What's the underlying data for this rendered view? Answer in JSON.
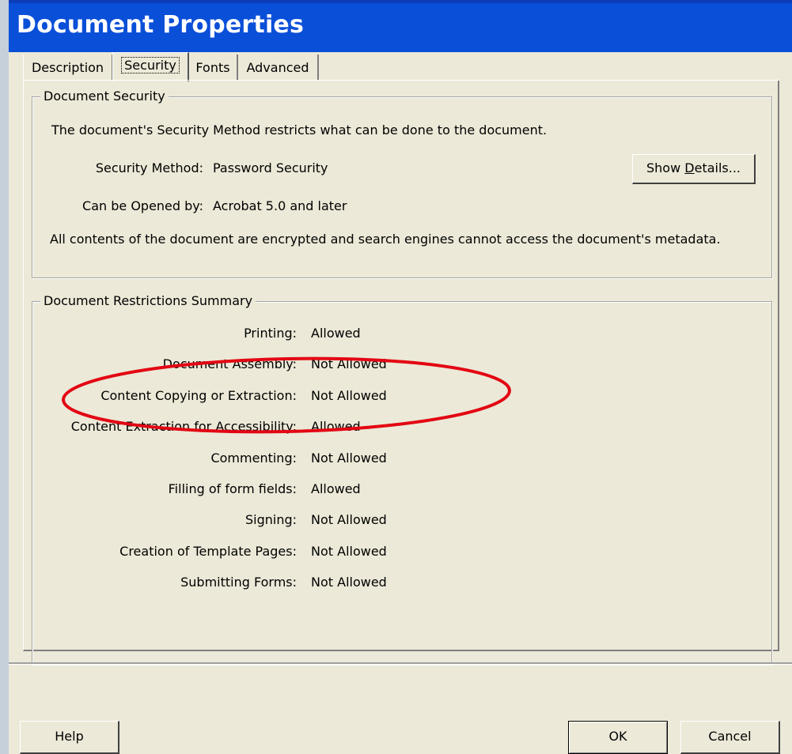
{
  "window": {
    "title": "Document Properties"
  },
  "tabs": [
    {
      "label": "Description",
      "active": false
    },
    {
      "label": "Security",
      "active": true
    },
    {
      "label": "Fonts",
      "active": false
    },
    {
      "label": "Advanced",
      "active": false
    }
  ],
  "security_group": {
    "legend": "Document Security",
    "intro": "The document's Security Method restricts what can be done to the document.",
    "method_label": "Security Method:",
    "method_value": "Password Security",
    "opened_label": "Can be Opened by:",
    "opened_value": "Acrobat 5.0 and later",
    "encryption_note": "All contents of the document are encrypted and search engines cannot access the document's metadata.",
    "show_details_label": "Show Details...",
    "show_details_mnemonic": "D"
  },
  "restrictions_group": {
    "legend": "Document Restrictions Summary",
    "rows": [
      {
        "label": "Printing:",
        "value": "Allowed"
      },
      {
        "label": "Document Assembly:",
        "value": "Not Allowed"
      },
      {
        "label": "Content Copying or Extraction:",
        "value": "Not Allowed"
      },
      {
        "label": "Content Extraction for Accessibility:",
        "value": "Allowed"
      },
      {
        "label": "Commenting:",
        "value": "Not Allowed"
      },
      {
        "label": "Filling of form fields:",
        "value": "Allowed"
      },
      {
        "label": "Signing:",
        "value": "Not Allowed"
      },
      {
        "label": "Creation of Template Pages:",
        "value": "Not Allowed"
      },
      {
        "label": "Submitting Forms:",
        "value": "Not Allowed"
      }
    ]
  },
  "footer": {
    "help_label": "Help",
    "ok_label": "OK",
    "cancel_label": "Cancel"
  },
  "annotation": {
    "type": "ellipse",
    "color": "#e30613",
    "highlights": "Content Copying or Extraction"
  },
  "colors": {
    "titlebar": "#0a4fd8",
    "dialog_bg": "#ece9d8"
  }
}
